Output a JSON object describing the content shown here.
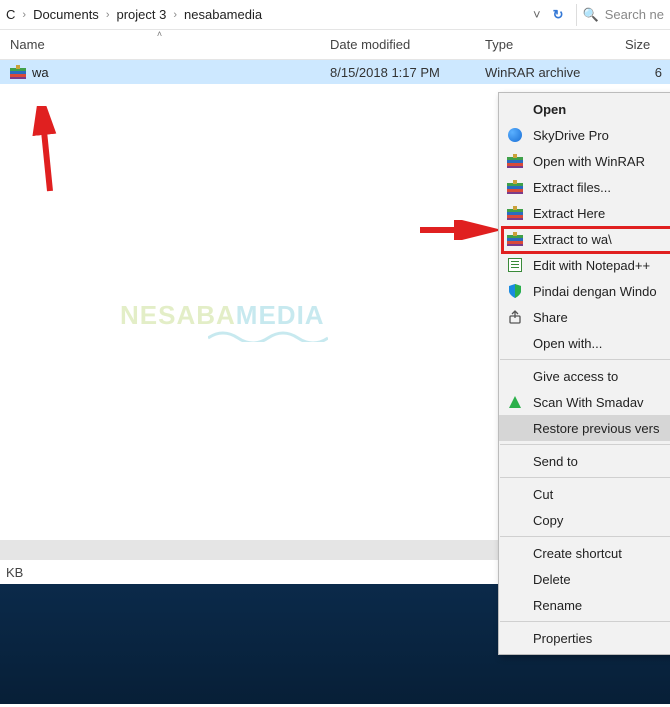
{
  "breadcrumb": {
    "part1": "C",
    "part2": "Documents",
    "part3": "project 3",
    "part4": "nesabamedia",
    "search_placeholder": "Search ne"
  },
  "columns": {
    "name": "Name",
    "date": "Date modified",
    "type": "Type",
    "size": "Size"
  },
  "file": {
    "name": "wa",
    "date": "8/15/2018 1:17 PM",
    "type": "WinRAR archive",
    "size": "6"
  },
  "statusbar": {
    "kb": "KB"
  },
  "watermark": {
    "a": "NESABA",
    "b": "MEDIA"
  },
  "context_menu": {
    "open": "Open",
    "skydrive": "SkyDrive Pro",
    "open_winrar": "Open with WinRAR",
    "extract_files": "Extract files...",
    "extract_here": "Extract Here",
    "extract_to": "Extract to wa\\",
    "edit_notepad": "Edit with Notepad++",
    "pindai": "Pindai dengan Windo",
    "share": "Share",
    "open_with": "Open with...",
    "give_access": "Give access to",
    "scan_smadav": "Scan With Smadav",
    "restore_prev": "Restore previous vers",
    "send_to": "Send to",
    "cut": "Cut",
    "copy": "Copy",
    "create_shortcut": "Create shortcut",
    "delete": "Delete",
    "rename": "Rename",
    "properties": "Properties"
  }
}
